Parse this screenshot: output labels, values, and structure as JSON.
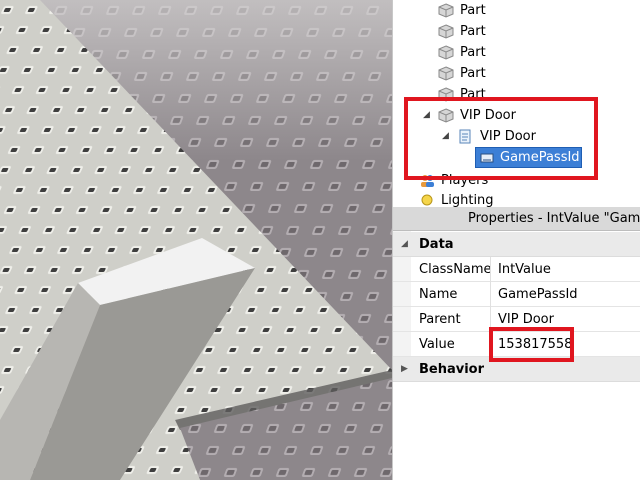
{
  "explorer": {
    "items": [
      {
        "label": "Part"
      },
      {
        "label": "Part"
      },
      {
        "label": "Part"
      },
      {
        "label": "Part"
      },
      {
        "label": "Part"
      },
      {
        "label": "VIP Door"
      },
      {
        "label": "VIP Door"
      },
      {
        "label": "GamePassId"
      },
      {
        "label": "Players"
      },
      {
        "label": "Lighting"
      }
    ]
  },
  "properties": {
    "title": "Properties - IntValue \"GameP",
    "categories": [
      {
        "label": "Data"
      },
      {
        "label": "Behavior"
      }
    ],
    "rows": [
      {
        "name": "ClassName",
        "value": "IntValue"
      },
      {
        "name": "Name",
        "value": "GamePassId"
      },
      {
        "name": "Parent",
        "value": "VIP Door"
      },
      {
        "name": "Value",
        "value": "153817558"
      }
    ]
  },
  "colors": {
    "highlight_box": "#e0161f",
    "selection": "#3c7fd6"
  }
}
